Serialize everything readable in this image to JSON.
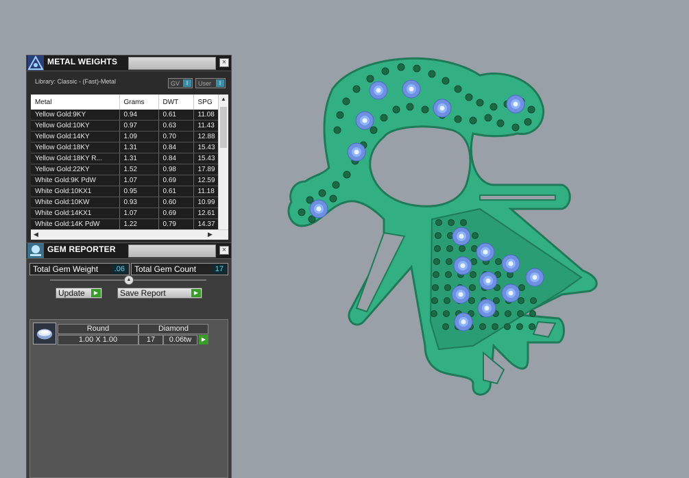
{
  "metal_weights": {
    "title": "METAL WEIGHTS",
    "library_label": "Library: Classic - (Fast)-Metal",
    "toggle_gv": "GV",
    "toggle_user": "User",
    "toggle_btn": "I",
    "columns": [
      "Metal",
      "Grams",
      "DWT",
      "SPG"
    ],
    "rows": [
      [
        "Yellow Gold:9KY",
        "0.94",
        "0.61",
        "11.08"
      ],
      [
        "Yellow Gold:10KY",
        "0.97",
        "0.63",
        "11.43"
      ],
      [
        "Yellow Gold:14KY",
        "1.09",
        "0.70",
        "12.88"
      ],
      [
        "Yellow Gold:18KY",
        "1.31",
        "0.84",
        "15.43"
      ],
      [
        "Yellow Gold:18KY R...",
        "1.31",
        "0.84",
        "15.43"
      ],
      [
        "Yellow Gold:22KY",
        "1.52",
        "0.98",
        "17.89"
      ],
      [
        "White Gold:9K PdW",
        "1.07",
        "0.69",
        "12.59"
      ],
      [
        "White Gold:10KX1",
        "0.95",
        "0.61",
        "11.18"
      ],
      [
        "White Gold:10KW",
        "0.93",
        "0.60",
        "10.99"
      ],
      [
        "White Gold:14KX1",
        "1.07",
        "0.69",
        "12.61"
      ],
      [
        "White Gold:14K PdW",
        "1.22",
        "0.79",
        "14.37"
      ]
    ]
  },
  "gem_reporter": {
    "title": "GEM REPORTER",
    "total_gem_weight_label": "Total Gem Weight",
    "total_gem_weight_value": ".06",
    "total_gem_count_label": "Total Gem Count",
    "total_gem_count_value": "17",
    "update_label": "Update",
    "save_report_label": "Save Report",
    "gem": {
      "shape": "Round",
      "material": "Diamond",
      "size": "1.00 X 1.00",
      "count": "17",
      "weight": "0.06tw"
    }
  },
  "close_glyph": "×",
  "colors": {
    "background": "#9aa0a8",
    "pendant_green": "#3cb88a",
    "bead_green": "#1a6a45",
    "gem_blue": "#8fb4ff"
  }
}
